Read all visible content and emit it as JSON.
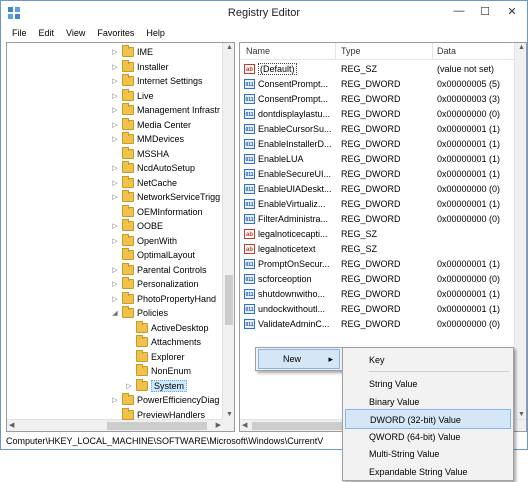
{
  "window": {
    "title": "Registry Editor",
    "minimize": "—",
    "maximize": "☐",
    "close": "✕"
  },
  "menu": [
    "File",
    "Edit",
    "View",
    "Favorites",
    "Help"
  ],
  "tree": [
    {
      "label": "IME",
      "exp": "▷",
      "lvl": 0
    },
    {
      "label": "Installer",
      "exp": "▷",
      "lvl": 0
    },
    {
      "label": "Internet Settings",
      "exp": "▷",
      "lvl": 0
    },
    {
      "label": "Live",
      "exp": "▷",
      "lvl": 0
    },
    {
      "label": "Management Infrastr",
      "exp": "▷",
      "lvl": 0
    },
    {
      "label": "Media Center",
      "exp": "▷",
      "lvl": 0
    },
    {
      "label": "MMDevices",
      "exp": "▷",
      "lvl": 0
    },
    {
      "label": "MSSHA",
      "exp": "",
      "lvl": 0
    },
    {
      "label": "NcdAutoSetup",
      "exp": "▷",
      "lvl": 0
    },
    {
      "label": "NetCache",
      "exp": "▷",
      "lvl": 0
    },
    {
      "label": "NetworkServiceTrigg",
      "exp": "▷",
      "lvl": 0
    },
    {
      "label": "OEMInformation",
      "exp": "",
      "lvl": 0
    },
    {
      "label": "OOBE",
      "exp": "▷",
      "lvl": 0
    },
    {
      "label": "OpenWith",
      "exp": "▷",
      "lvl": 0
    },
    {
      "label": "OptimalLayout",
      "exp": "",
      "lvl": 0
    },
    {
      "label": "Parental Controls",
      "exp": "▷",
      "lvl": 0
    },
    {
      "label": "Personalization",
      "exp": "▷",
      "lvl": 0
    },
    {
      "label": "PhotoPropertyHand",
      "exp": "▷",
      "lvl": 0
    },
    {
      "label": "Policies",
      "exp": "◢",
      "lvl": 0
    },
    {
      "label": "ActiveDesktop",
      "exp": "",
      "lvl": 1
    },
    {
      "label": "Attachments",
      "exp": "",
      "lvl": 1
    },
    {
      "label": "Explorer",
      "exp": "",
      "lvl": 1
    },
    {
      "label": "NonEnum",
      "exp": "",
      "lvl": 1
    },
    {
      "label": "System",
      "exp": "▷",
      "lvl": 1,
      "selected": true
    },
    {
      "label": "PowerEfficiencyDiag",
      "exp": "▷",
      "lvl": 0
    },
    {
      "label": "PreviewHandlers",
      "exp": "",
      "lvl": 0
    }
  ],
  "list": {
    "headers": {
      "name": "Name",
      "type": "Type",
      "data": "Data"
    },
    "rows": [
      {
        "icon": "ab",
        "kind": "sz",
        "name": "(Default)",
        "type": "REG_SZ",
        "data": "(value not set)",
        "focus": true
      },
      {
        "icon": "011",
        "kind": "dw",
        "name": "ConsentPrompt...",
        "type": "REG_DWORD",
        "data": "0x00000005 (5)"
      },
      {
        "icon": "011",
        "kind": "dw",
        "name": "ConsentPrompt...",
        "type": "REG_DWORD",
        "data": "0x00000003 (3)"
      },
      {
        "icon": "011",
        "kind": "dw",
        "name": "dontdisplaylastu...",
        "type": "REG_DWORD",
        "data": "0x00000000 (0)"
      },
      {
        "icon": "011",
        "kind": "dw",
        "name": "EnableCursorSu...",
        "type": "REG_DWORD",
        "data": "0x00000001 (1)"
      },
      {
        "icon": "011",
        "kind": "dw",
        "name": "EnableInstallerD...",
        "type": "REG_DWORD",
        "data": "0x00000001 (1)"
      },
      {
        "icon": "011",
        "kind": "dw",
        "name": "EnableLUA",
        "type": "REG_DWORD",
        "data": "0x00000001 (1)"
      },
      {
        "icon": "011",
        "kind": "dw",
        "name": "EnableSecureUI...",
        "type": "REG_DWORD",
        "data": "0x00000001 (1)"
      },
      {
        "icon": "011",
        "kind": "dw",
        "name": "EnableUIADeskt...",
        "type": "REG_DWORD",
        "data": "0x00000000 (0)"
      },
      {
        "icon": "011",
        "kind": "dw",
        "name": "EnableVirtualiz...",
        "type": "REG_DWORD",
        "data": "0x00000001 (1)"
      },
      {
        "icon": "011",
        "kind": "dw",
        "name": "FilterAdministra...",
        "type": "REG_DWORD",
        "data": "0x00000000 (0)"
      },
      {
        "icon": "ab",
        "kind": "sz",
        "name": "legalnoticecapti...",
        "type": "REG_SZ",
        "data": ""
      },
      {
        "icon": "ab",
        "kind": "sz",
        "name": "legalnoticetext",
        "type": "REG_SZ",
        "data": ""
      },
      {
        "icon": "011",
        "kind": "dw",
        "name": "PromptOnSecur...",
        "type": "REG_DWORD",
        "data": "0x00000001 (1)"
      },
      {
        "icon": "011",
        "kind": "dw",
        "name": "scforceoption",
        "type": "REG_DWORD",
        "data": "0x00000000 (0)"
      },
      {
        "icon": "011",
        "kind": "dw",
        "name": "shutdownwitho...",
        "type": "REG_DWORD",
        "data": "0x00000001 (1)"
      },
      {
        "icon": "011",
        "kind": "dw",
        "name": "undockwithoutl...",
        "type": "REG_DWORD",
        "data": "0x00000001 (1)"
      },
      {
        "icon": "011",
        "kind": "dw",
        "name": "ValidateAdminC...",
        "type": "REG_DWORD",
        "data": "0x00000000 (0)"
      }
    ]
  },
  "context_menu": {
    "new_label": "New",
    "arrow": "▸"
  },
  "submenu": [
    {
      "label": "Key"
    },
    {
      "sep": true
    },
    {
      "label": "String Value"
    },
    {
      "label": "Binary Value"
    },
    {
      "label": "DWORD (32-bit) Value",
      "highlighted": true
    },
    {
      "label": "QWORD (64-bit) Value"
    },
    {
      "label": "Multi-String Value"
    },
    {
      "label": "Expandable String Value"
    }
  ],
  "status_path": "Computer\\HKEY_LOCAL_MACHINE\\SOFTWARE\\Microsoft\\Windows\\CurrentV"
}
